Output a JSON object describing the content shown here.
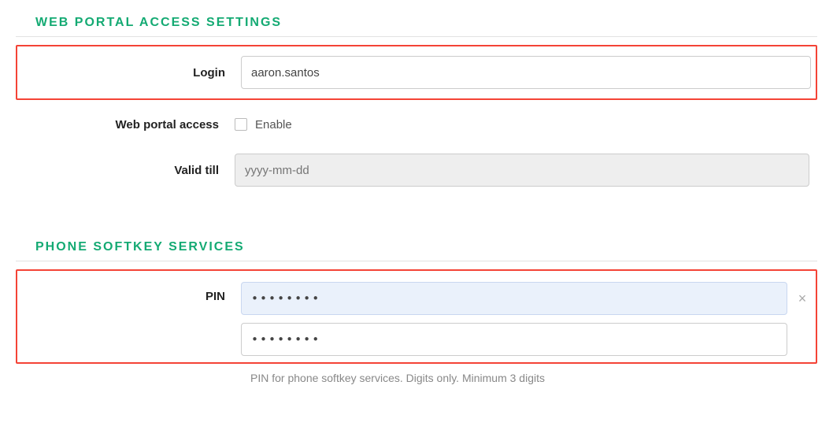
{
  "sections": {
    "web": {
      "title": "WEB PORTAL ACCESS SETTINGS",
      "login_label": "Login",
      "login_value": "aaron.santos",
      "access_label": "Web portal access",
      "access_checkbox_label": "Enable",
      "access_enabled": false,
      "valid_label": "Valid till",
      "valid_placeholder": "yyyy-mm-dd",
      "valid_value": ""
    },
    "phone": {
      "title": "PHONE SOFTKEY SERVICES",
      "pin_label": "PIN",
      "pin_value": "••••••••",
      "pin_confirm_value": "••••••••",
      "help_text": "PIN for phone softkey services. Digits only. Minimum 3 digits",
      "clear_icon": "×"
    }
  }
}
